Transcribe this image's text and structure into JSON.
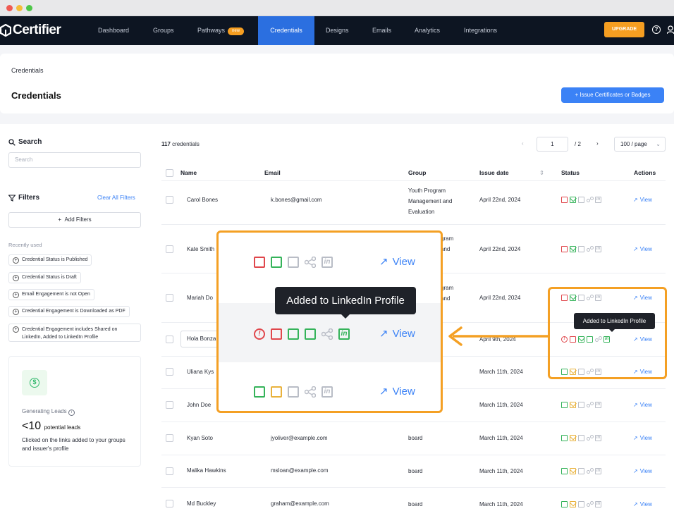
{
  "brand": {
    "name": "Certifier",
    "accent": "#2b6fe0",
    "orange": "#f59e21"
  },
  "nav": {
    "items": [
      "Dashboard",
      "Groups",
      "Pathways",
      "Credentials",
      "Designs",
      "Emails",
      "Analytics",
      "Integrations"
    ],
    "new_badge": "new",
    "active": "Credentials",
    "upgrade_label": "UPGRADE"
  },
  "header": {
    "breadcrumb": "Credentials",
    "title": "Credentials",
    "issue_button": "Issue Certificates or Badges"
  },
  "sidebar": {
    "search_label": "Search",
    "search_placeholder": "Search",
    "filters_label": "Filters",
    "clear_all": "Clear All Filters",
    "add_filters": "Add Filters",
    "recently_used": "Recently used",
    "chips": [
      "Credential Status is Published",
      "Credential Status is Draft",
      "Email Engagement is not Open",
      "Credential Engagement is Downloaded as PDF",
      "Credential Engagement includes Shared on LinkedIn, Added to LinkedIn Profile"
    ],
    "leads": {
      "title": "Generating Leads",
      "value": "<10",
      "unit": "potential leads",
      "desc": "Clicked on the links added to your groups and issuer's profile"
    }
  },
  "table": {
    "count": "117",
    "count_label": "credentials",
    "page": "1",
    "total_pages": "/ 2",
    "per_page": "100 / page",
    "columns": [
      "Name",
      "Email",
      "Group",
      "Issue date",
      "Status",
      "Actions"
    ],
    "rows": [
      {
        "name": "Carol Bones",
        "email": "k.bones@gmail.com",
        "group": "Youth Program Management and Evaluation",
        "date": "April 22nd, 2024"
      },
      {
        "name": "Kate Smith",
        "email": "",
        "group": "",
        "date": "April 22nd, 2024"
      },
      {
        "name": "Mariah Do",
        "email": "",
        "group": "",
        "date": "April 22nd, 2024"
      },
      {
        "name": "Hola Bonza",
        "email": "",
        "group": "",
        "date": "April 9th, 2024"
      },
      {
        "name": "Uliana Kys",
        "email": "",
        "group": "",
        "date": "March 11th, 2024"
      },
      {
        "name": "John Doe",
        "email": "",
        "group": "",
        "date": "March 11th, 2024"
      },
      {
        "name": "Kyan Soto",
        "email": "jyoliver@example.com",
        "group": "board",
        "date": "March 11th, 2024"
      },
      {
        "name": "Malika Hawkins",
        "email": "msloan@example.com",
        "group": "board",
        "date": "March 11th, 2024"
      },
      {
        "name": "Md Buckley",
        "email": "graham@example.com",
        "group": "board",
        "date": "March 11th, 2024"
      }
    ],
    "group_partial": [
      "gram",
      "and",
      "gram",
      "and"
    ],
    "view_label": "View",
    "tooltip": "Added to LinkedIn Profile"
  },
  "zoom": {
    "view_label": "View",
    "tooltip": "Added to LinkedIn Profile"
  }
}
